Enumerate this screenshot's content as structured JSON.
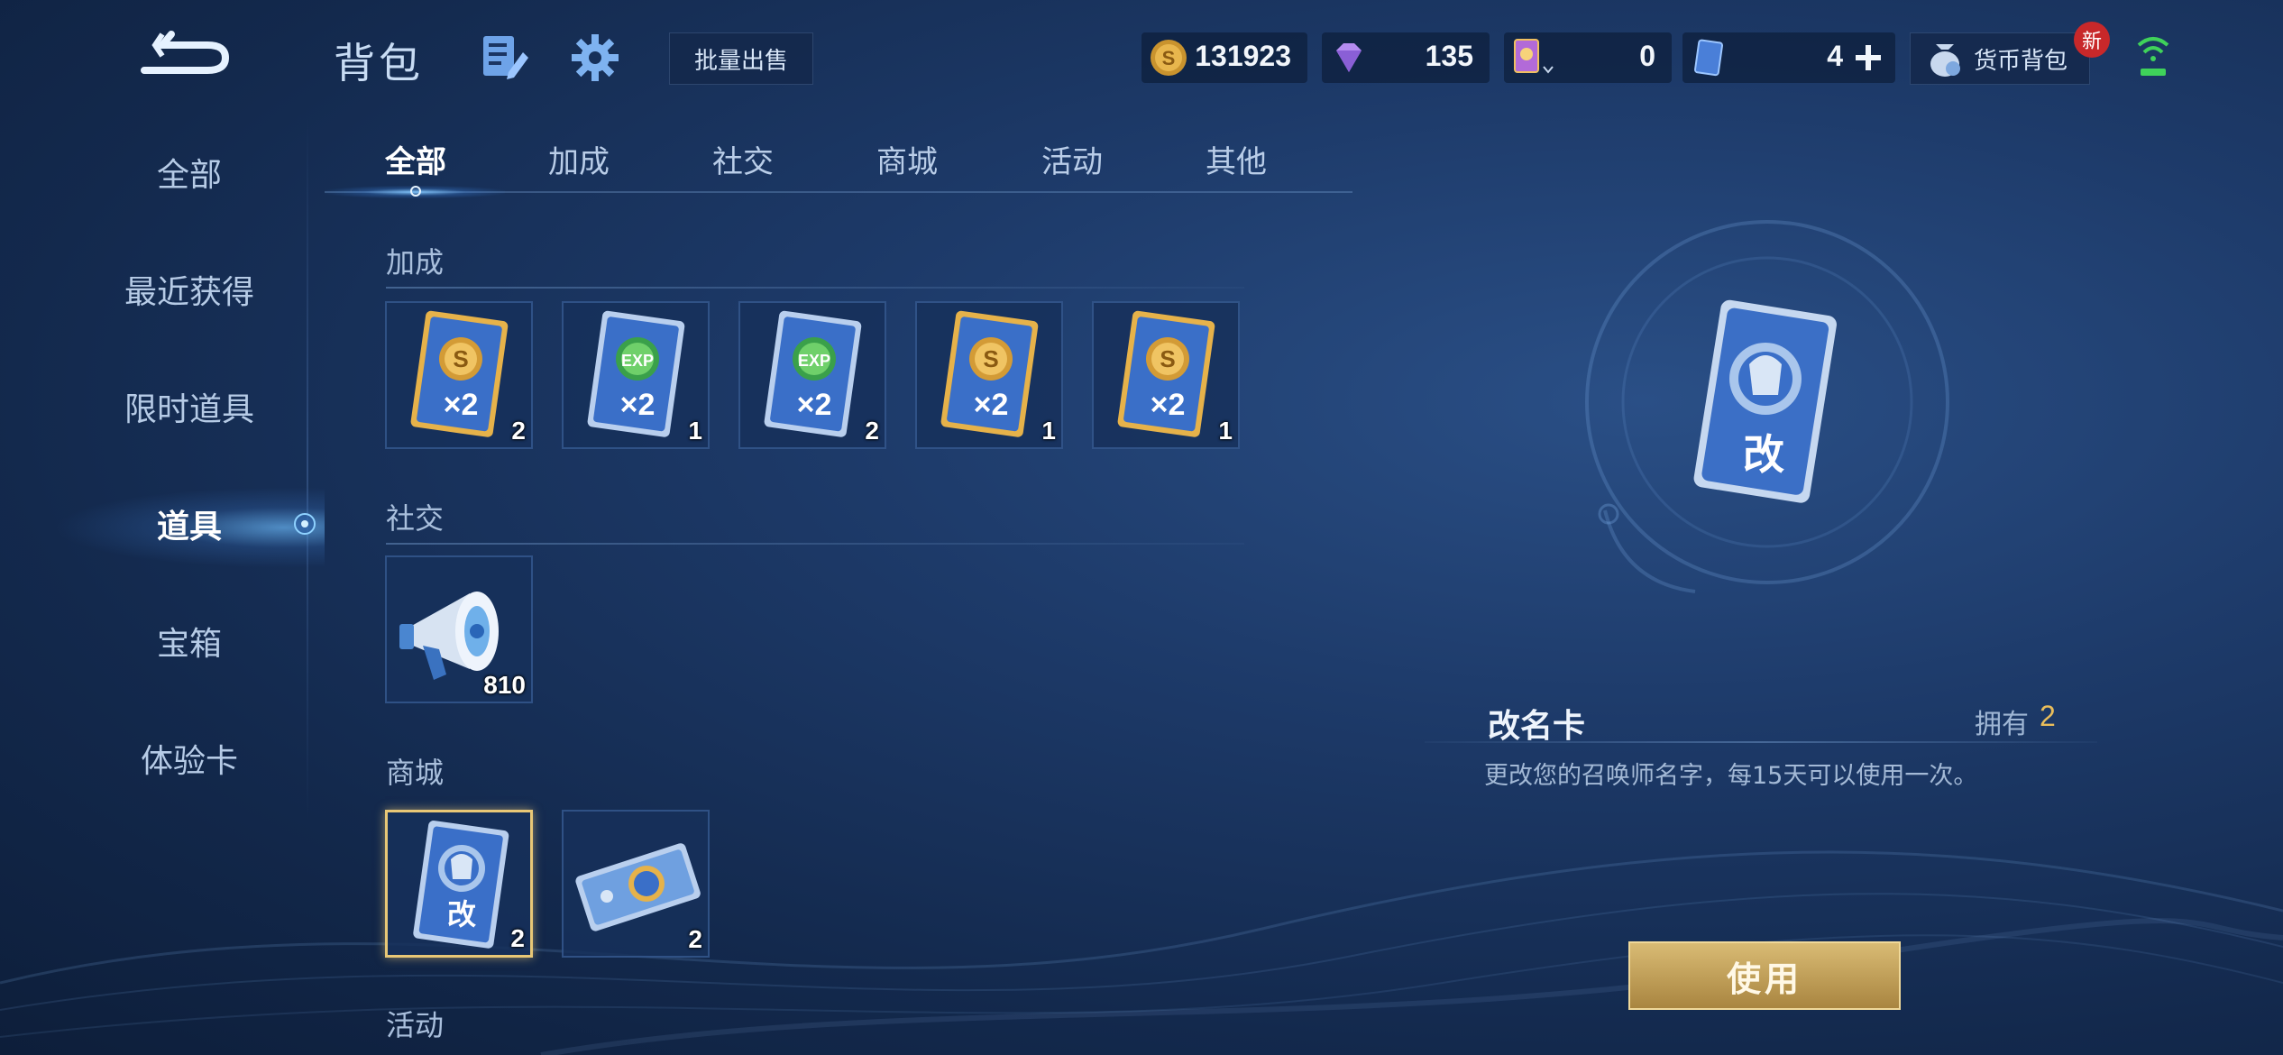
{
  "header": {
    "title": "背包",
    "bulk_sell_label": "批量出售",
    "currencies": [
      {
        "name": "gold-coin",
        "value": "131923"
      },
      {
        "name": "diamond",
        "value": "135"
      },
      {
        "name": "card-ticket",
        "value": "0"
      },
      {
        "name": "blue-coupon",
        "value": "4"
      }
    ],
    "wallet_label": "货币背包",
    "new_badge": "新"
  },
  "sidebar": {
    "items": [
      {
        "label": "全部"
      },
      {
        "label": "最近获得"
      },
      {
        "label": "限时道具"
      },
      {
        "label": "道具",
        "active": true
      },
      {
        "label": "宝箱"
      },
      {
        "label": "体验卡"
      }
    ]
  },
  "tabs": [
    {
      "label": "全部",
      "active": true
    },
    {
      "label": "加成"
    },
    {
      "label": "社交"
    },
    {
      "label": "商城"
    },
    {
      "label": "活动"
    },
    {
      "label": "其他"
    }
  ],
  "sections": {
    "bonus": {
      "title": "加成",
      "items": [
        {
          "icon": "gold-x2-card-icon",
          "count": "2"
        },
        {
          "icon": "exp-x2-card-icon",
          "count": "1"
        },
        {
          "icon": "exp-x2-card-icon",
          "count": "2"
        },
        {
          "icon": "gold-x2-card-icon",
          "count": "1"
        },
        {
          "icon": "gold-x2-card-icon",
          "count": "1"
        }
      ]
    },
    "social": {
      "title": "社交",
      "items": [
        {
          "icon": "megaphone-icon",
          "count": "810"
        }
      ]
    },
    "shop": {
      "title": "商城",
      "items": [
        {
          "icon": "rename-card-icon",
          "count": "2",
          "selected": true
        },
        {
          "icon": "ticket-icon",
          "count": "2"
        }
      ]
    },
    "event": {
      "title": "活动"
    }
  },
  "card_glyphs": {
    "x2": "×2",
    "gold_symbol": "S",
    "exp_symbol": "EXP",
    "rename_symbol": "改"
  },
  "detail": {
    "name": "改名卡",
    "own_label": "拥有",
    "own_count": "2",
    "description": "更改您的召唤师名字，每15天可以使用一次。",
    "use_label": "使用"
  },
  "colors": {
    "accent_gold": "#e9bd5b",
    "bg_dark": "#13294d",
    "active_tab": "#ffffff"
  }
}
